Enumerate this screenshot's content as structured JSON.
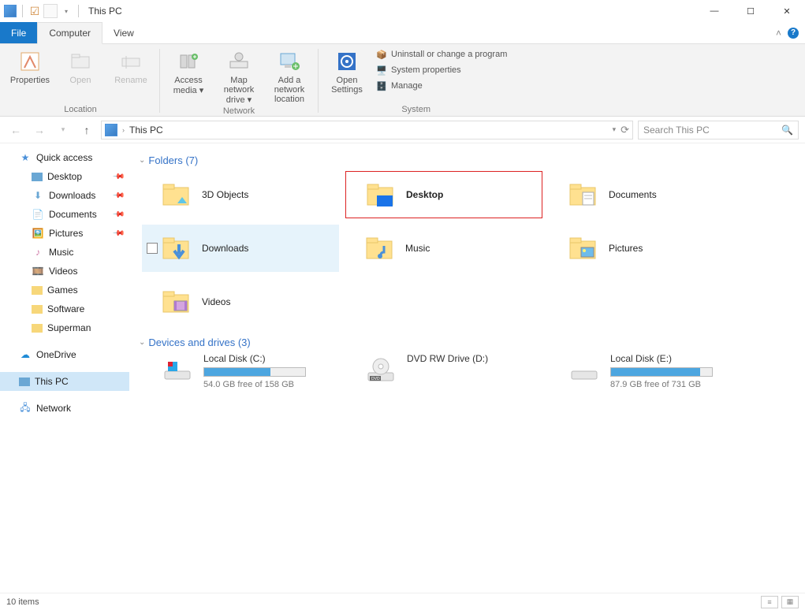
{
  "window": {
    "title": "This PC",
    "controls": {
      "min": "—",
      "max": "☐",
      "close": "✕"
    }
  },
  "ribbon_tabs": {
    "file": "File",
    "computer": "Computer",
    "view": "View"
  },
  "ribbon": {
    "location": {
      "label": "Location",
      "properties": "Properties",
      "open": "Open",
      "rename": "Rename"
    },
    "network": {
      "label": "Network",
      "access_media": "Access media ▾",
      "map_drive": "Map network drive ▾",
      "add_location": "Add a network location"
    },
    "settings": {
      "open_settings": "Open Settings"
    },
    "system": {
      "label": "System",
      "uninstall": "Uninstall or change a program",
      "sysprops": "System properties",
      "manage": "Manage"
    }
  },
  "nav": {
    "address": "This PC",
    "search_placeholder": "Search This PC"
  },
  "sidebar": {
    "quick": "Quick access",
    "items": [
      "Desktop",
      "Downloads",
      "Documents",
      "Pictures",
      "Music",
      "Videos",
      "Games",
      "Software",
      "Superman"
    ],
    "onedrive": "OneDrive",
    "thispc": "This PC",
    "network": "Network"
  },
  "sections": {
    "folders": "Folders (7)",
    "drives": "Devices and drives (3)"
  },
  "folders": [
    {
      "name": "3D Objects",
      "kind": "3d"
    },
    {
      "name": "Desktop",
      "kind": "desktop"
    },
    {
      "name": "Documents",
      "kind": "documents"
    },
    {
      "name": "Downloads",
      "kind": "downloads"
    },
    {
      "name": "Music",
      "kind": "music"
    },
    {
      "name": "Pictures",
      "kind": "pictures"
    },
    {
      "name": "Videos",
      "kind": "videos"
    }
  ],
  "drives": [
    {
      "name": "Local Disk (C:)",
      "free": "54.0 GB free of 158 GB",
      "fill": 66
    },
    {
      "name": "DVD RW Drive (D:)",
      "free": "",
      "fill": -1
    },
    {
      "name": "Local Disk (E:)",
      "free": "87.9 GB free of 731 GB",
      "fill": 88
    }
  ],
  "status": {
    "text": "10 items"
  }
}
